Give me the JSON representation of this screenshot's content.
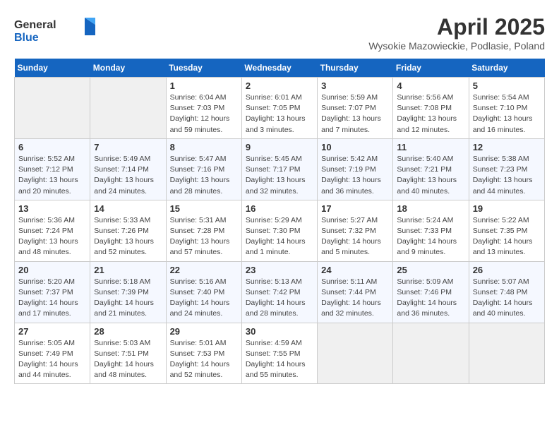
{
  "header": {
    "logo_general": "General",
    "logo_blue": "Blue",
    "month_year": "April 2025",
    "location": "Wysokie Mazowieckie, Podlasie, Poland"
  },
  "weekdays": [
    "Sunday",
    "Monday",
    "Tuesday",
    "Wednesday",
    "Thursday",
    "Friday",
    "Saturday"
  ],
  "weeks": [
    [
      {
        "day": "",
        "info": ""
      },
      {
        "day": "",
        "info": ""
      },
      {
        "day": "1",
        "info": "Sunrise: 6:04 AM\nSunset: 7:03 PM\nDaylight: 12 hours\nand 59 minutes."
      },
      {
        "day": "2",
        "info": "Sunrise: 6:01 AM\nSunset: 7:05 PM\nDaylight: 13 hours\nand 3 minutes."
      },
      {
        "day": "3",
        "info": "Sunrise: 5:59 AM\nSunset: 7:07 PM\nDaylight: 13 hours\nand 7 minutes."
      },
      {
        "day": "4",
        "info": "Sunrise: 5:56 AM\nSunset: 7:08 PM\nDaylight: 13 hours\nand 12 minutes."
      },
      {
        "day": "5",
        "info": "Sunrise: 5:54 AM\nSunset: 7:10 PM\nDaylight: 13 hours\nand 16 minutes."
      }
    ],
    [
      {
        "day": "6",
        "info": "Sunrise: 5:52 AM\nSunset: 7:12 PM\nDaylight: 13 hours\nand 20 minutes."
      },
      {
        "day": "7",
        "info": "Sunrise: 5:49 AM\nSunset: 7:14 PM\nDaylight: 13 hours\nand 24 minutes."
      },
      {
        "day": "8",
        "info": "Sunrise: 5:47 AM\nSunset: 7:16 PM\nDaylight: 13 hours\nand 28 minutes."
      },
      {
        "day": "9",
        "info": "Sunrise: 5:45 AM\nSunset: 7:17 PM\nDaylight: 13 hours\nand 32 minutes."
      },
      {
        "day": "10",
        "info": "Sunrise: 5:42 AM\nSunset: 7:19 PM\nDaylight: 13 hours\nand 36 minutes."
      },
      {
        "day": "11",
        "info": "Sunrise: 5:40 AM\nSunset: 7:21 PM\nDaylight: 13 hours\nand 40 minutes."
      },
      {
        "day": "12",
        "info": "Sunrise: 5:38 AM\nSunset: 7:23 PM\nDaylight: 13 hours\nand 44 minutes."
      }
    ],
    [
      {
        "day": "13",
        "info": "Sunrise: 5:36 AM\nSunset: 7:24 PM\nDaylight: 13 hours\nand 48 minutes."
      },
      {
        "day": "14",
        "info": "Sunrise: 5:33 AM\nSunset: 7:26 PM\nDaylight: 13 hours\nand 52 minutes."
      },
      {
        "day": "15",
        "info": "Sunrise: 5:31 AM\nSunset: 7:28 PM\nDaylight: 13 hours\nand 57 minutes."
      },
      {
        "day": "16",
        "info": "Sunrise: 5:29 AM\nSunset: 7:30 PM\nDaylight: 14 hours\nand 1 minute."
      },
      {
        "day": "17",
        "info": "Sunrise: 5:27 AM\nSunset: 7:32 PM\nDaylight: 14 hours\nand 5 minutes."
      },
      {
        "day": "18",
        "info": "Sunrise: 5:24 AM\nSunset: 7:33 PM\nDaylight: 14 hours\nand 9 minutes."
      },
      {
        "day": "19",
        "info": "Sunrise: 5:22 AM\nSunset: 7:35 PM\nDaylight: 14 hours\nand 13 minutes."
      }
    ],
    [
      {
        "day": "20",
        "info": "Sunrise: 5:20 AM\nSunset: 7:37 PM\nDaylight: 14 hours\nand 17 minutes."
      },
      {
        "day": "21",
        "info": "Sunrise: 5:18 AM\nSunset: 7:39 PM\nDaylight: 14 hours\nand 21 minutes."
      },
      {
        "day": "22",
        "info": "Sunrise: 5:16 AM\nSunset: 7:40 PM\nDaylight: 14 hours\nand 24 minutes."
      },
      {
        "day": "23",
        "info": "Sunrise: 5:13 AM\nSunset: 7:42 PM\nDaylight: 14 hours\nand 28 minutes."
      },
      {
        "day": "24",
        "info": "Sunrise: 5:11 AM\nSunset: 7:44 PM\nDaylight: 14 hours\nand 32 minutes."
      },
      {
        "day": "25",
        "info": "Sunrise: 5:09 AM\nSunset: 7:46 PM\nDaylight: 14 hours\nand 36 minutes."
      },
      {
        "day": "26",
        "info": "Sunrise: 5:07 AM\nSunset: 7:48 PM\nDaylight: 14 hours\nand 40 minutes."
      }
    ],
    [
      {
        "day": "27",
        "info": "Sunrise: 5:05 AM\nSunset: 7:49 PM\nDaylight: 14 hours\nand 44 minutes."
      },
      {
        "day": "28",
        "info": "Sunrise: 5:03 AM\nSunset: 7:51 PM\nDaylight: 14 hours\nand 48 minutes."
      },
      {
        "day": "29",
        "info": "Sunrise: 5:01 AM\nSunset: 7:53 PM\nDaylight: 14 hours\nand 52 minutes."
      },
      {
        "day": "30",
        "info": "Sunrise: 4:59 AM\nSunset: 7:55 PM\nDaylight: 14 hours\nand 55 minutes."
      },
      {
        "day": "",
        "info": ""
      },
      {
        "day": "",
        "info": ""
      },
      {
        "day": "",
        "info": ""
      }
    ]
  ]
}
